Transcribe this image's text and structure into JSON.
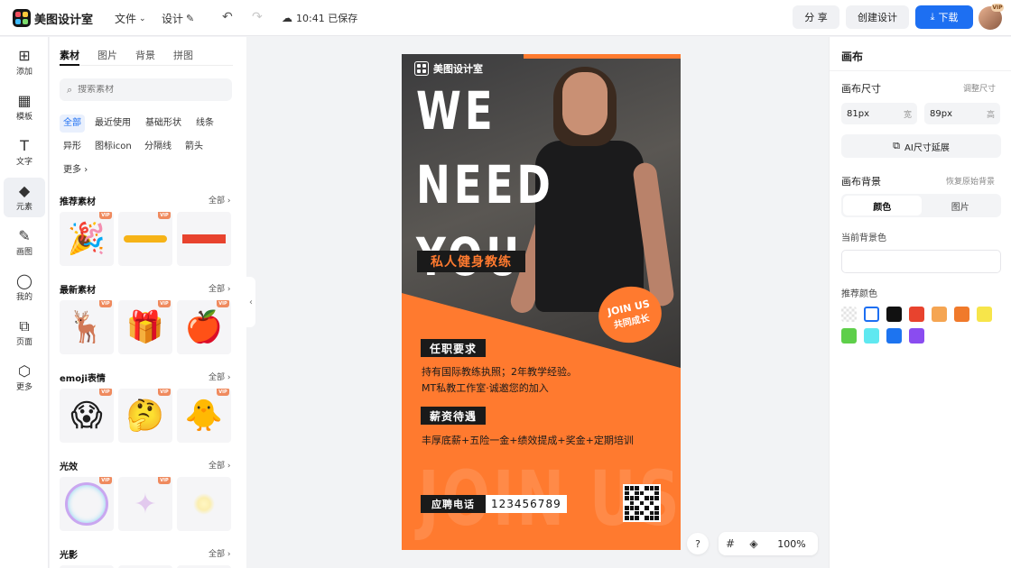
{
  "topbar": {
    "brand": "美图设计室",
    "menu_file": "文件",
    "menu_design": "设计",
    "saved": "10:41 已保存",
    "share": "分 享",
    "create": "创建设计",
    "download": "下载",
    "vip": "VIP"
  },
  "rail": [
    {
      "label": "添加",
      "icon": "⊞"
    },
    {
      "label": "模板",
      "icon": "▦"
    },
    {
      "label": "文字",
      "icon": "T"
    },
    {
      "label": "元素",
      "icon": "◆"
    },
    {
      "label": "画图",
      "icon": "✎"
    },
    {
      "label": "我的",
      "icon": "◯"
    },
    {
      "label": "页面",
      "icon": "⧉"
    },
    {
      "label": "更多",
      "icon": "⬡"
    }
  ],
  "panel": {
    "tabs": [
      "素材",
      "图片",
      "背景",
      "拼图"
    ],
    "search_placeholder": "搜索素材",
    "chips": [
      "全部",
      "最近使用",
      "基础形状",
      "线条",
      "异形",
      "图标icon",
      "分隔线",
      "箭头",
      "更多"
    ],
    "all_label": "全部",
    "vip": "VIP",
    "sections": [
      {
        "title": "推荐素材"
      },
      {
        "title": "最新素材"
      },
      {
        "title": "emoji表情"
      },
      {
        "title": "光效"
      },
      {
        "title": "光影"
      }
    ]
  },
  "poster": {
    "brand": "美图设计室",
    "headline": [
      "WE",
      "NEED",
      "YOU"
    ],
    "tag": "私人健身教练",
    "join_line1": "JOIN US",
    "join_line2": "共同成长",
    "req_title": "任职要求",
    "req_line1": "持有国际教练执照；2年教学经验。",
    "req_line2": "MT私教工作室·诚邀您的加入",
    "pay_title": "薪资待遇",
    "pay_line": "丰厚底薪+五险一金+绩效提成+奖金+定期培训",
    "watermark": "JOIN US",
    "phone_label": "应聘电话",
    "phone_value": "123456789",
    "accent": "#ff7a2f"
  },
  "bottom": {
    "help": "?",
    "zoom": "100%"
  },
  "right": {
    "title": "画布",
    "size_label": "画布尺寸",
    "adjust_size": "调整尺寸",
    "width_value": "81px",
    "width_unit": "宽",
    "height_value": "89px",
    "height_unit": "高",
    "ai_button": "AI尺寸延展",
    "bg_label": "画布背景",
    "restore_bg": "恢复原始背景",
    "seg_color": "颜色",
    "seg_image": "图片",
    "current_bg": "当前背景色",
    "recommended": "推荐颜色",
    "swatches": [
      "transparent",
      "#ffffff",
      "#111111",
      "#e8432e",
      "#f5a552",
      "#f07a2b",
      "#f7e54a",
      "#5ecf4a",
      "#5fe8f0",
      "#1d74f0",
      "#8a4cf0"
    ]
  }
}
